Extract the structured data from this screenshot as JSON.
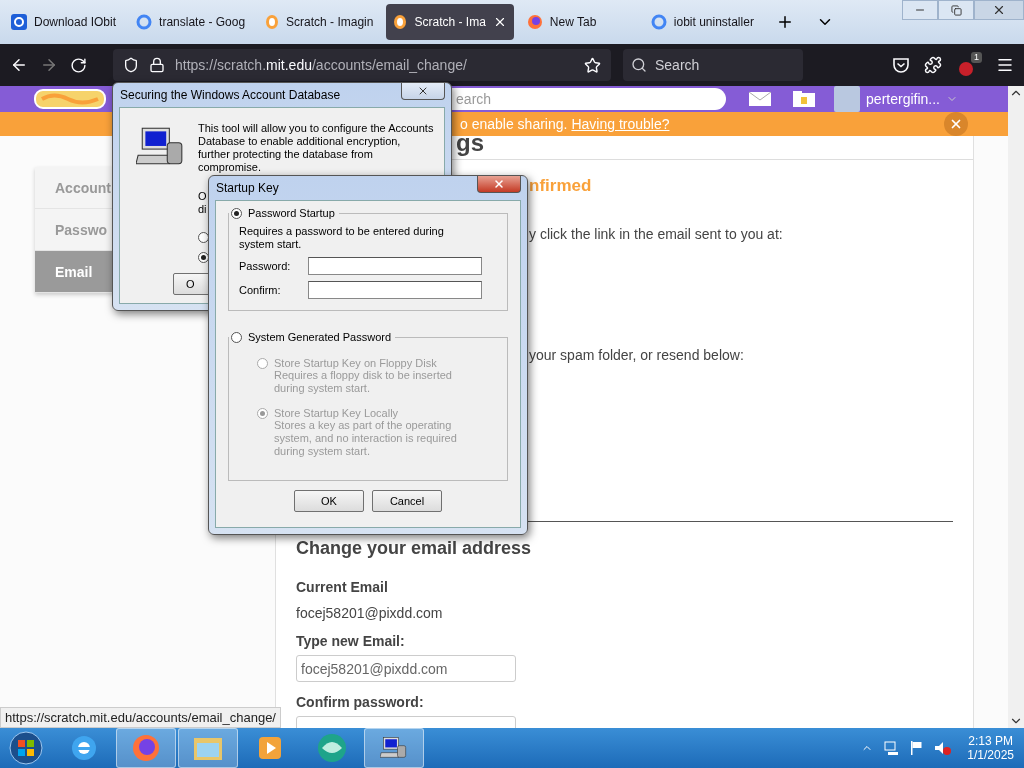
{
  "tabs": [
    {
      "title": "Download IObit",
      "kind": "iobit",
      "selected": false
    },
    {
      "title": "translate - Goog",
      "kind": "google",
      "selected": false
    },
    {
      "title": "Scratch - Imagin",
      "kind": "scratch",
      "selected": false
    },
    {
      "title": "Scratch - Ima",
      "kind": "scratch",
      "selected": true
    },
    {
      "title": "New Tab",
      "kind": "firefox",
      "selected": false
    },
    {
      "title": "iobit uninstaller",
      "kind": "google",
      "selected": false
    }
  ],
  "address": {
    "prefix": "https://scratch.",
    "domain": "mit.edu",
    "path": "/accounts/email_change/"
  },
  "search": {
    "placeholder": "Search"
  },
  "extension_badge": "1",
  "scratch_header": {
    "search_placeholder": "earch",
    "username": "pertergifin..."
  },
  "banner": {
    "text": "o enable sharing.",
    "link": "Having trouble?"
  },
  "settings": {
    "heading": "gs",
    "nav": [
      {
        "label": "Account",
        "selected": false
      },
      {
        "label": "Passwo",
        "selected": false
      },
      {
        "label": "Email",
        "selected": true
      }
    ],
    "status_title": "nfirmed",
    "line_1": "y click the link in the email sent to you at:",
    "line_2": "your spam folder, or resend below:",
    "change": {
      "heading": "Change your email address",
      "current_label": "Current Email",
      "current_value": "focej58201@pixdd.com",
      "new_label": "Type new Email:",
      "new_value": "focej58201@pixdd.com",
      "confirm_label": "Confirm password:"
    }
  },
  "status_url": "https://scratch.mit.edu/accounts/email_change/",
  "securing_dialog": {
    "title": "Securing the Windows Account Database",
    "description": "This tool will allow you to configure the Accounts Database to enable additional encryption, further protecting the database from compromise.",
    "partial_1": "O",
    "partial_2": "di",
    "radios": [
      {
        "selected": false
      },
      {
        "selected": true
      }
    ],
    "button": "O"
  },
  "startup_dialog": {
    "title": "Startup Key",
    "password_option": {
      "label": "Password Startup",
      "selected": true,
      "description": "Requires a password to be entered during system start.",
      "password_label": "Password:",
      "confirm_label": "Confirm:"
    },
    "system_option": {
      "label": "System Generated Password",
      "selected": false,
      "choices": [
        {
          "label": "Store Startup Key on Floppy Disk",
          "description": "Requires a floppy disk to be inserted during system start.",
          "selected": false,
          "disabled": true
        },
        {
          "label": "Store Startup Key Locally",
          "description": "Stores a key as part of the operating system, and no interaction is required during system start.",
          "selected": true,
          "disabled": true
        }
      ]
    },
    "buttons": [
      "OK",
      "Cancel"
    ]
  },
  "taskbar": {
    "apps": [
      {
        "kind": "ie",
        "active": false
      },
      {
        "kind": "firefox",
        "active": true
      },
      {
        "kind": "explorer",
        "active": true
      },
      {
        "kind": "media",
        "active": false
      },
      {
        "kind": "globe",
        "active": false
      },
      {
        "kind": "computer",
        "active": true
      }
    ],
    "time": "2:13 PM",
    "date": "1/1/2025"
  }
}
